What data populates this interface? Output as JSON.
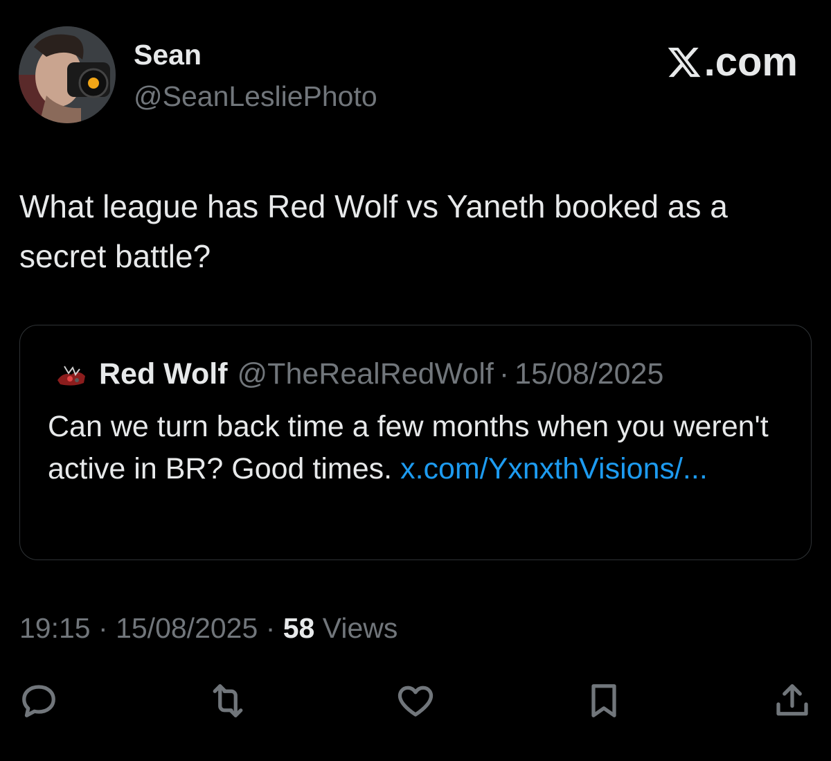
{
  "author": {
    "name": "Sean",
    "handle": "@SeanLesliePhoto"
  },
  "brand": {
    "label": ".com"
  },
  "tweet": {
    "text": "What league has Red Wolf vs Yaneth booked as a secret battle?"
  },
  "quote": {
    "name": "Red Wolf",
    "handle": "@TheRealRedWolf",
    "separator": "·",
    "date": "15/08/2025",
    "text": "Can we turn back time a few months when you weren't active in BR? Good times. ",
    "link": "x.com/YxnxthVisions/..."
  },
  "meta": {
    "time": "19:15",
    "separator": "·",
    "date": "15/08/2025",
    "views_count": "58",
    "views_label": "Views"
  },
  "actions": [
    {
      "name": "reply",
      "icon": "reply-icon"
    },
    {
      "name": "repost",
      "icon": "repost-icon"
    },
    {
      "name": "like",
      "icon": "heart-icon"
    },
    {
      "name": "bookmark",
      "icon": "bookmark-icon"
    },
    {
      "name": "share",
      "icon": "share-icon"
    }
  ],
  "colors": {
    "background": "#000000",
    "primary_text": "#e7e9ea",
    "secondary_text": "#71767b",
    "link": "#1d9bf0",
    "border": "#2f3336"
  }
}
